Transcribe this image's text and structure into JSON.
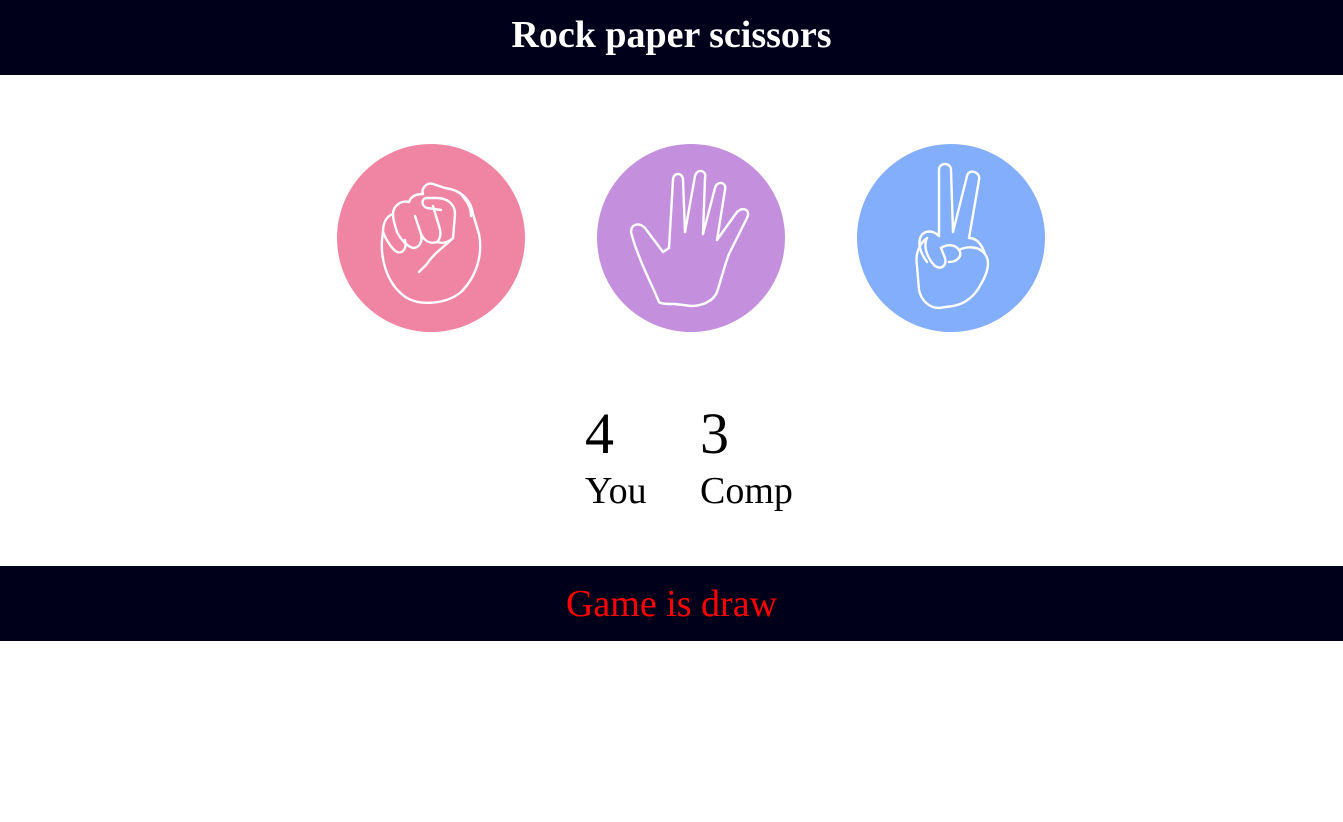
{
  "header": {
    "title": "Rock paper scissors"
  },
  "choices": [
    {
      "id": "rock",
      "icon": "fist-icon",
      "color": "#f085a3"
    },
    {
      "id": "paper",
      "icon": "open-hand-icon",
      "color": "#c490de"
    },
    {
      "id": "scissors",
      "icon": "peace-hand-icon",
      "color": "#82aefc"
    }
  ],
  "scores": {
    "user": {
      "value": "4",
      "label": "You"
    },
    "comp": {
      "value": "3",
      "label": "Comp"
    }
  },
  "message": {
    "text": "Game is draw",
    "color": "#ff0000"
  },
  "colors": {
    "bar_background": "#00001a",
    "header_text": "#ffffff"
  }
}
